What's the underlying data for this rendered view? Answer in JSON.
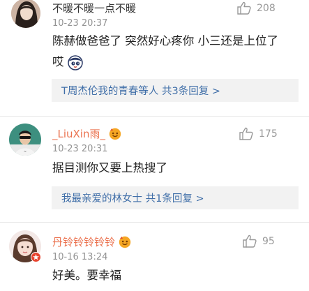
{
  "comments": [
    {
      "username": "不暖不暖一点不暖",
      "time": "10-23 20:37",
      "text_line1": "陈赫做爸爸了 突然好心疼你 小三还是上位了",
      "text_line2": "哎",
      "likes": "208",
      "replies_label": "T周杰伦我的青春等人 共3条回复 >"
    },
    {
      "username": "_LiuXin雨_",
      "time": "10-23 20:31",
      "text_line1": "据目测你又要上热搜了",
      "likes": "175",
      "replies_label": "我最亲爱的林女士 共1条回复 >"
    },
    {
      "username": "丹铃铃铃铃铃",
      "time": "10-16 13:24",
      "text_line1": "好美。要幸福",
      "likes": "95"
    }
  ],
  "colors": {
    "vip_name": "#eb7350",
    "reply_link": "#3f6ea8",
    "reply_bg": "#f2f2f2",
    "meta_gray": "#939393"
  }
}
